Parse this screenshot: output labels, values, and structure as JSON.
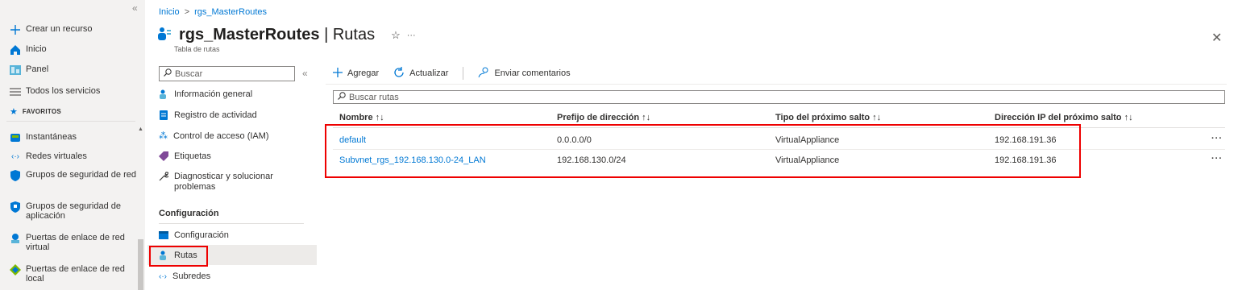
{
  "portal_nav": {
    "items": [
      {
        "label": "Crear un recurso",
        "icon": "plus-icon"
      },
      {
        "label": "Inicio",
        "icon": "home-icon"
      },
      {
        "label": "Panel",
        "icon": "dashboard-icon"
      },
      {
        "label": "Todos los servicios",
        "icon": "list-icon"
      }
    ],
    "favorites_header": "FAVORITOS",
    "favorites": [
      {
        "label": "Instantáneas",
        "icon": "snapshot-icon"
      },
      {
        "label": "Redes virtuales",
        "icon": "vnet-icon"
      },
      {
        "label": "Grupos de seguridad de red",
        "icon": "shield-icon"
      },
      {
        "label": "Grupos de seguridad de aplicación",
        "icon": "app-shield-icon"
      },
      {
        "label": "Puertas de enlace de red virtual",
        "icon": "vpn-gateway-icon"
      },
      {
        "label": "Puertas de enlace de red local",
        "icon": "local-gateway-icon"
      }
    ]
  },
  "header": {
    "breadcrumb": [
      "Inicio",
      "rgs_MasterRoutes"
    ],
    "title_resource": "rgs_MasterRoutes",
    "title_sep": " | ",
    "title_blade": "Rutas",
    "subtitle": "Tabla de rutas"
  },
  "menu": {
    "search_placeholder": "Buscar",
    "items": [
      {
        "label": "Información general",
        "icon": "route-table-icon"
      },
      {
        "label": "Registro de actividad",
        "icon": "activity-log-icon"
      },
      {
        "label": "Control de acceso (IAM)",
        "icon": "iam-icon"
      },
      {
        "label": "Etiquetas",
        "icon": "tag-icon"
      },
      {
        "label": "Diagnosticar y solucionar problemas",
        "icon": "wrench-icon"
      }
    ],
    "section_title": "Configuración",
    "section_items": [
      {
        "label": "Configuración",
        "icon": "config-icon"
      },
      {
        "label": "Rutas",
        "icon": "routes-icon"
      },
      {
        "label": "Subredes",
        "icon": "subnet-icon"
      }
    ]
  },
  "toolbar": {
    "add_label": "Agregar",
    "refresh_label": "Actualizar",
    "feedback_label": "Enviar comentarios"
  },
  "routes": {
    "search_placeholder": "Buscar rutas",
    "columns": [
      "Nombre ↑↓",
      "Prefijo de dirección ↑↓",
      "Tipo del próximo salto ↑↓",
      "Dirección IP del próximo salto ↑↓"
    ],
    "rows": [
      {
        "name": "default",
        "prefix": "0.0.0.0/0",
        "hop_type": "VirtualAppliance",
        "hop_ip": "192.168.191.36"
      },
      {
        "name": "Subvnet_rgs_192.168.130.0-24_LAN",
        "prefix": "192.168.130.0/24",
        "hop_type": "VirtualAppliance",
        "hop_ip": "192.168.191.36"
      }
    ],
    "more_label": "···"
  },
  "colors": {
    "accent": "#0078d4",
    "highlight": "#e00000"
  }
}
